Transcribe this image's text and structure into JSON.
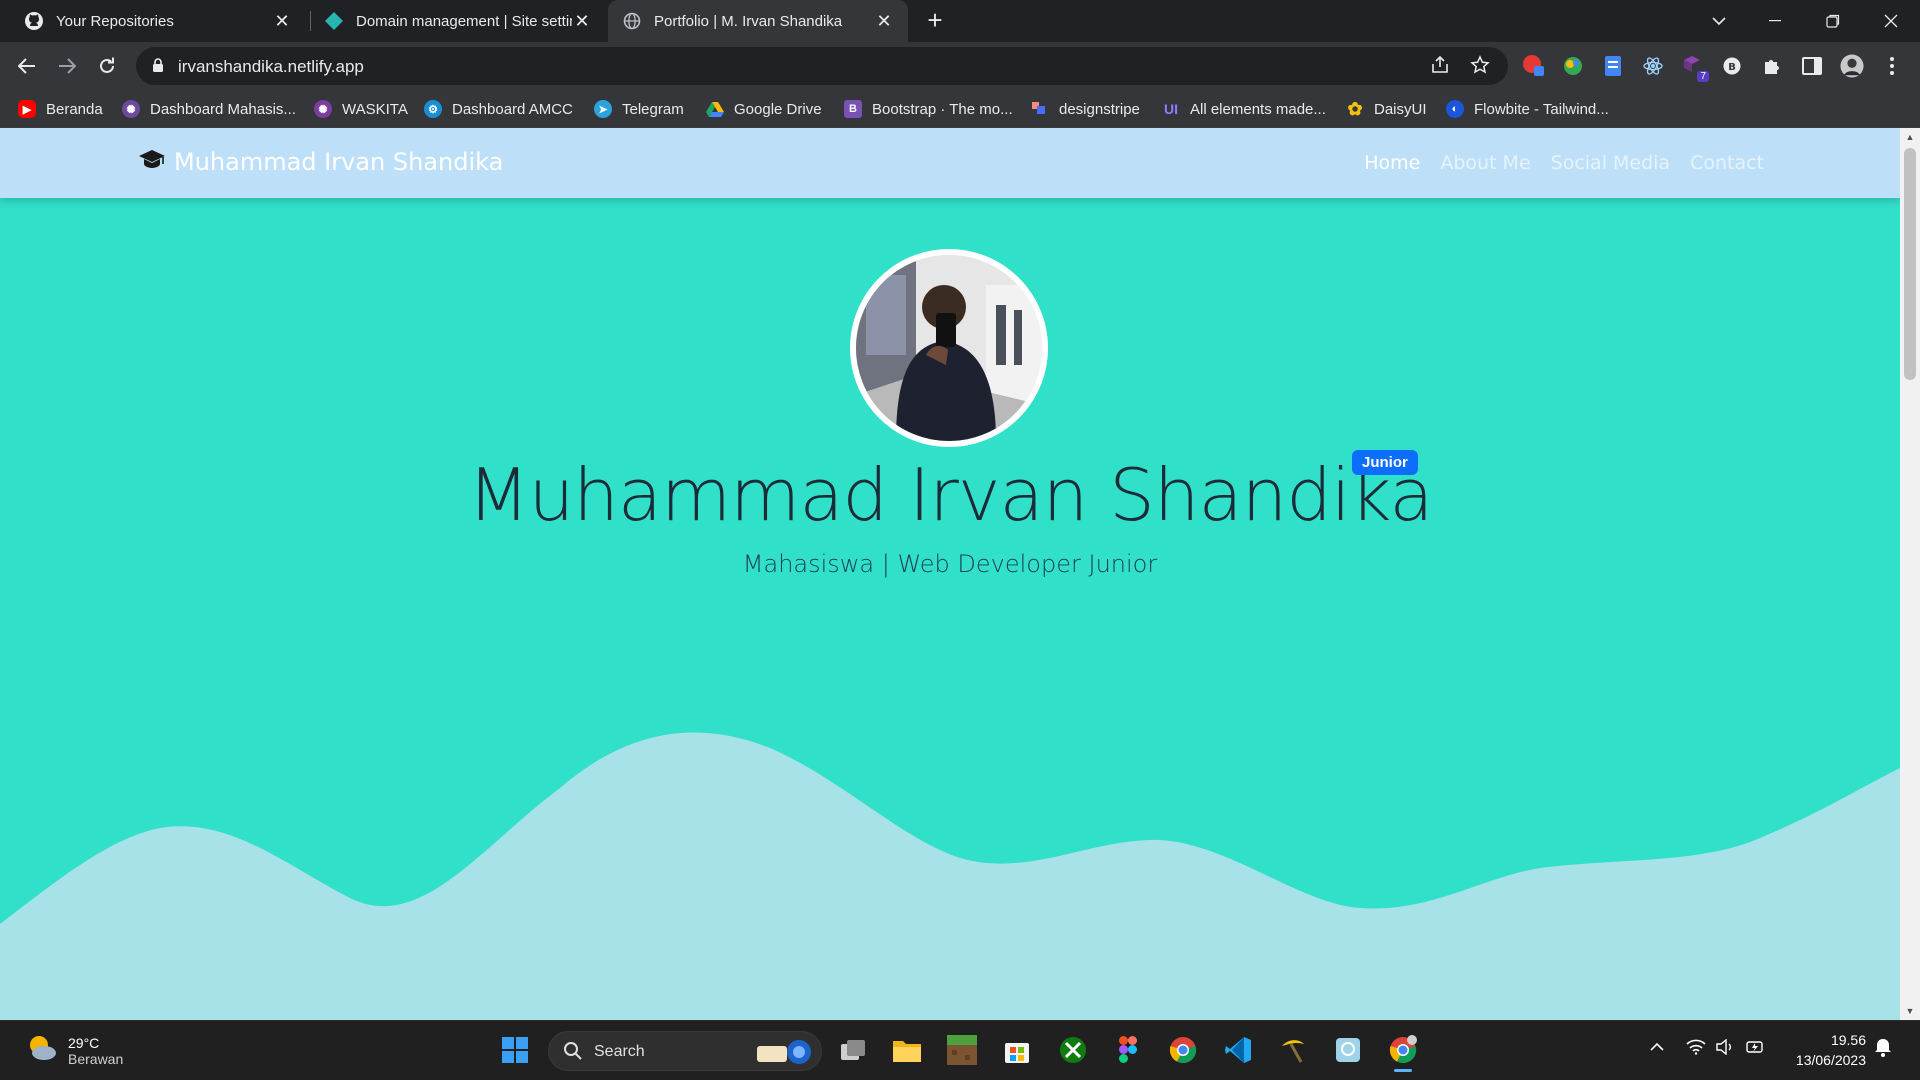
{
  "browser": {
    "tabs": [
      {
        "title": "Your Repositories",
        "icon": "github-icon",
        "active": false
      },
      {
        "title": "Domain management | Site settings",
        "icon": "netlify-icon",
        "active": false
      },
      {
        "title": "Portfolio | M. Irvan Shandika",
        "icon": "globe-icon",
        "active": true
      }
    ],
    "url": "irvanshandika.netlify.app",
    "extension_badge": "7"
  },
  "bookmarks": [
    {
      "label": "Beranda",
      "icon": "youtube-icon",
      "color": "#ff0000"
    },
    {
      "label": "Dashboard Mahasis...",
      "icon": "amikom-icon",
      "color": "#6b4aa0"
    },
    {
      "label": "WASKITA",
      "icon": "waskita-icon",
      "color": "#7b3fa0"
    },
    {
      "label": "Dashboard AMCC",
      "icon": "amcc-icon",
      "color": "#1a8fd8"
    },
    {
      "label": "Telegram",
      "icon": "telegram-icon",
      "color": "#2aa3df"
    },
    {
      "label": "Google Drive",
      "icon": "google-drive-icon",
      "color": "#1fa463"
    },
    {
      "label": "Bootstrap · The mo...",
      "icon": "bootstrap-icon",
      "color": "#7952b3"
    },
    {
      "label": "designstripe",
      "icon": "designstripe-icon",
      "color": "#4b6cf7"
    },
    {
      "label": "All elements made...",
      "icon": "uiverse-icon",
      "color": "#7a5af8"
    },
    {
      "label": "DaisyUI",
      "icon": "daisyui-icon",
      "color": "#f4c20d"
    },
    {
      "label": "Flowbite - Tailwind...",
      "icon": "flowbite-icon",
      "color": "#1a56db"
    }
  ],
  "site": {
    "brand": "Muhammad Irvan Shandika",
    "nav": [
      "Home",
      "About Me",
      "Social Media",
      "Contact"
    ],
    "active_nav": "Home",
    "hero_name": "Muhammad Irvan Shandika",
    "badge": "Junior",
    "subtitle": "Mahasiswa | Web Developer Junior",
    "colors": {
      "hero_bg": "#31e0c9",
      "navbar_bg": "#bde0f8",
      "wave": "#a6e2e8",
      "badge": "#0d6efd"
    }
  },
  "taskbar": {
    "weather_temp": "29°C",
    "weather_cond": "Berawan",
    "search_label": "Search",
    "time": "19.56",
    "date": "13/06/2023"
  }
}
